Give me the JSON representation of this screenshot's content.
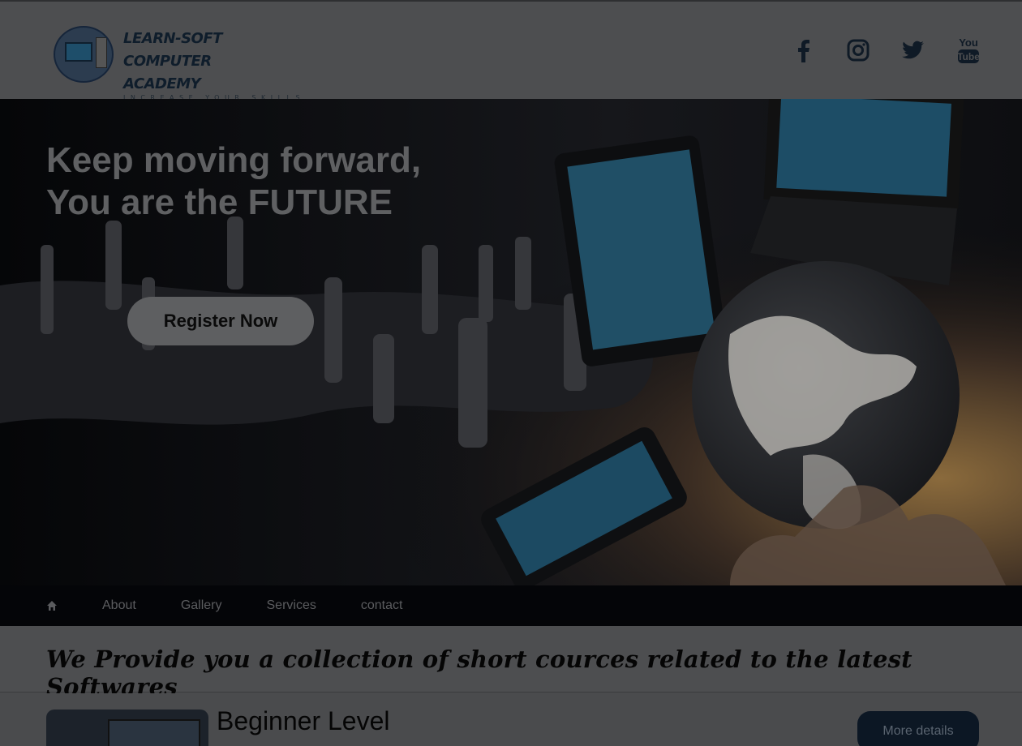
{
  "header": {
    "logo_title_line1": "LEARN-SOFT COMPUTER",
    "logo_title_line2": "ACADEMY",
    "logo_tagline": "INCREASE YOUR SKILLS",
    "socials": [
      {
        "icon": "facebook-icon"
      },
      {
        "icon": "instagram-icon"
      },
      {
        "icon": "twitter-icon"
      },
      {
        "icon": "youtube-icon",
        "label_top": "You",
        "label_bottom": "Tube"
      }
    ]
  },
  "hero": {
    "headline_line1": "Keep moving forward,",
    "headline_line2": "You are the FUTURE",
    "register_label": "Register Now"
  },
  "nav": {
    "home_icon": "home-icon",
    "items": [
      "About",
      "Gallery",
      "Services",
      "contact"
    ]
  },
  "tagline": "We Provide you a collection of short cources related to the latest Softwares",
  "course": {
    "title": "Beginner Level",
    "button_label": "More details"
  },
  "colors": {
    "overlay_bg": "#4d4e50",
    "nav_bg": "#040508",
    "button_dark": "#0c1724",
    "logo_text": "#0f1d2b"
  }
}
